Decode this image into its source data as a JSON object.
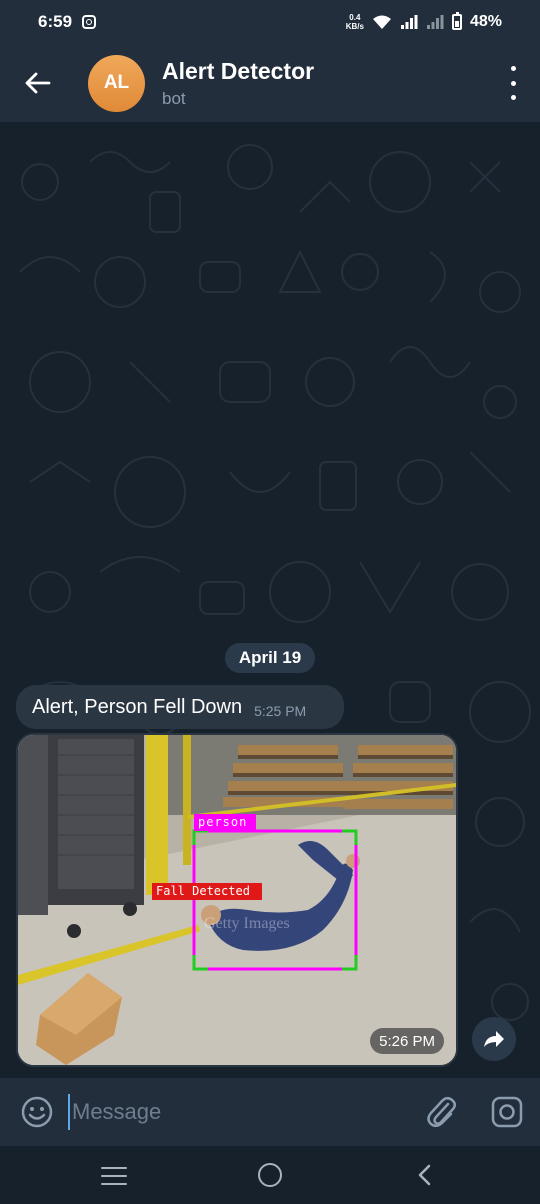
{
  "status_bar": {
    "time": "6:59",
    "net_speed_value": "0.4",
    "net_speed_unit": "KB/s",
    "battery": "48%"
  },
  "header": {
    "avatar_initials": "AL",
    "title": "Alert Detector",
    "subtitle": "bot"
  },
  "chat": {
    "date_label": "April 19",
    "messages": [
      {
        "text": "Alert, Person Fell Down",
        "time": "5:25 PM"
      }
    ],
    "photo": {
      "time": "5:26 PM",
      "detections": [
        {
          "label": "person",
          "color": "#ff00ff"
        },
        {
          "label": "Fall Detected",
          "color": "#e01818"
        }
      ],
      "watermark": "Getty Images"
    }
  },
  "input": {
    "placeholder": "Message"
  },
  "colors": {
    "header_bg": "#232e3c",
    "chat_bg": "#17212b",
    "bubble_bg": "#2b3643",
    "avatar": "#e8944a",
    "accent": "#5ea8e6"
  }
}
